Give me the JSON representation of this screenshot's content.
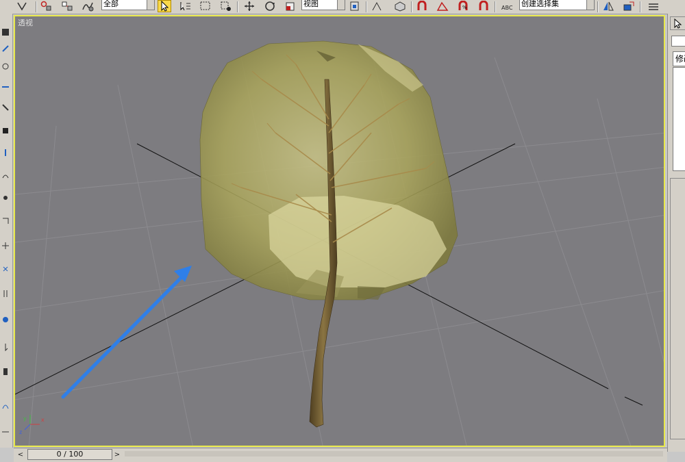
{
  "toolbar": {
    "selection_filter": "全部",
    "reference_coordinate": "视图",
    "named_selection_sets": "创建选择集",
    "icons": [
      "bind-to-space-warp-icon",
      "select-link-icon",
      "unlink-icon",
      "bind-space-warp-icon",
      "select-object-icon",
      "select-by-name-icon",
      "rectangular-selection-icon",
      "window-crossing-icon",
      "select-move-icon",
      "select-rotate-icon",
      "select-scale-icon",
      "use-pivot-icon",
      "select-manipulate-icon",
      "keyboard-shortcut-icon",
      "snaps-toggle-icon",
      "angle-snap-icon",
      "percent-snap-icon",
      "spinner-snap-icon",
      "edit-named-sets-icon",
      "mirror-icon",
      "align-icon",
      "layer-manager-icon"
    ]
  },
  "viewport": {
    "label": "透视",
    "background_color": "#7d7c80",
    "border_color": "#e8e84a",
    "axis_labels": {
      "x": "x",
      "y": "y",
      "z": "z"
    }
  },
  "command_panel": {
    "tab_label": "修改"
  },
  "time_slider": {
    "frame_display": "0 / 100",
    "prev_label": "<",
    "next_label": ">"
  },
  "colors": {
    "ui_gray": "#d4d0c8",
    "canopy": "#b8b46a",
    "trunk": "#6e5a34",
    "arrow": "#2f7fe8"
  }
}
